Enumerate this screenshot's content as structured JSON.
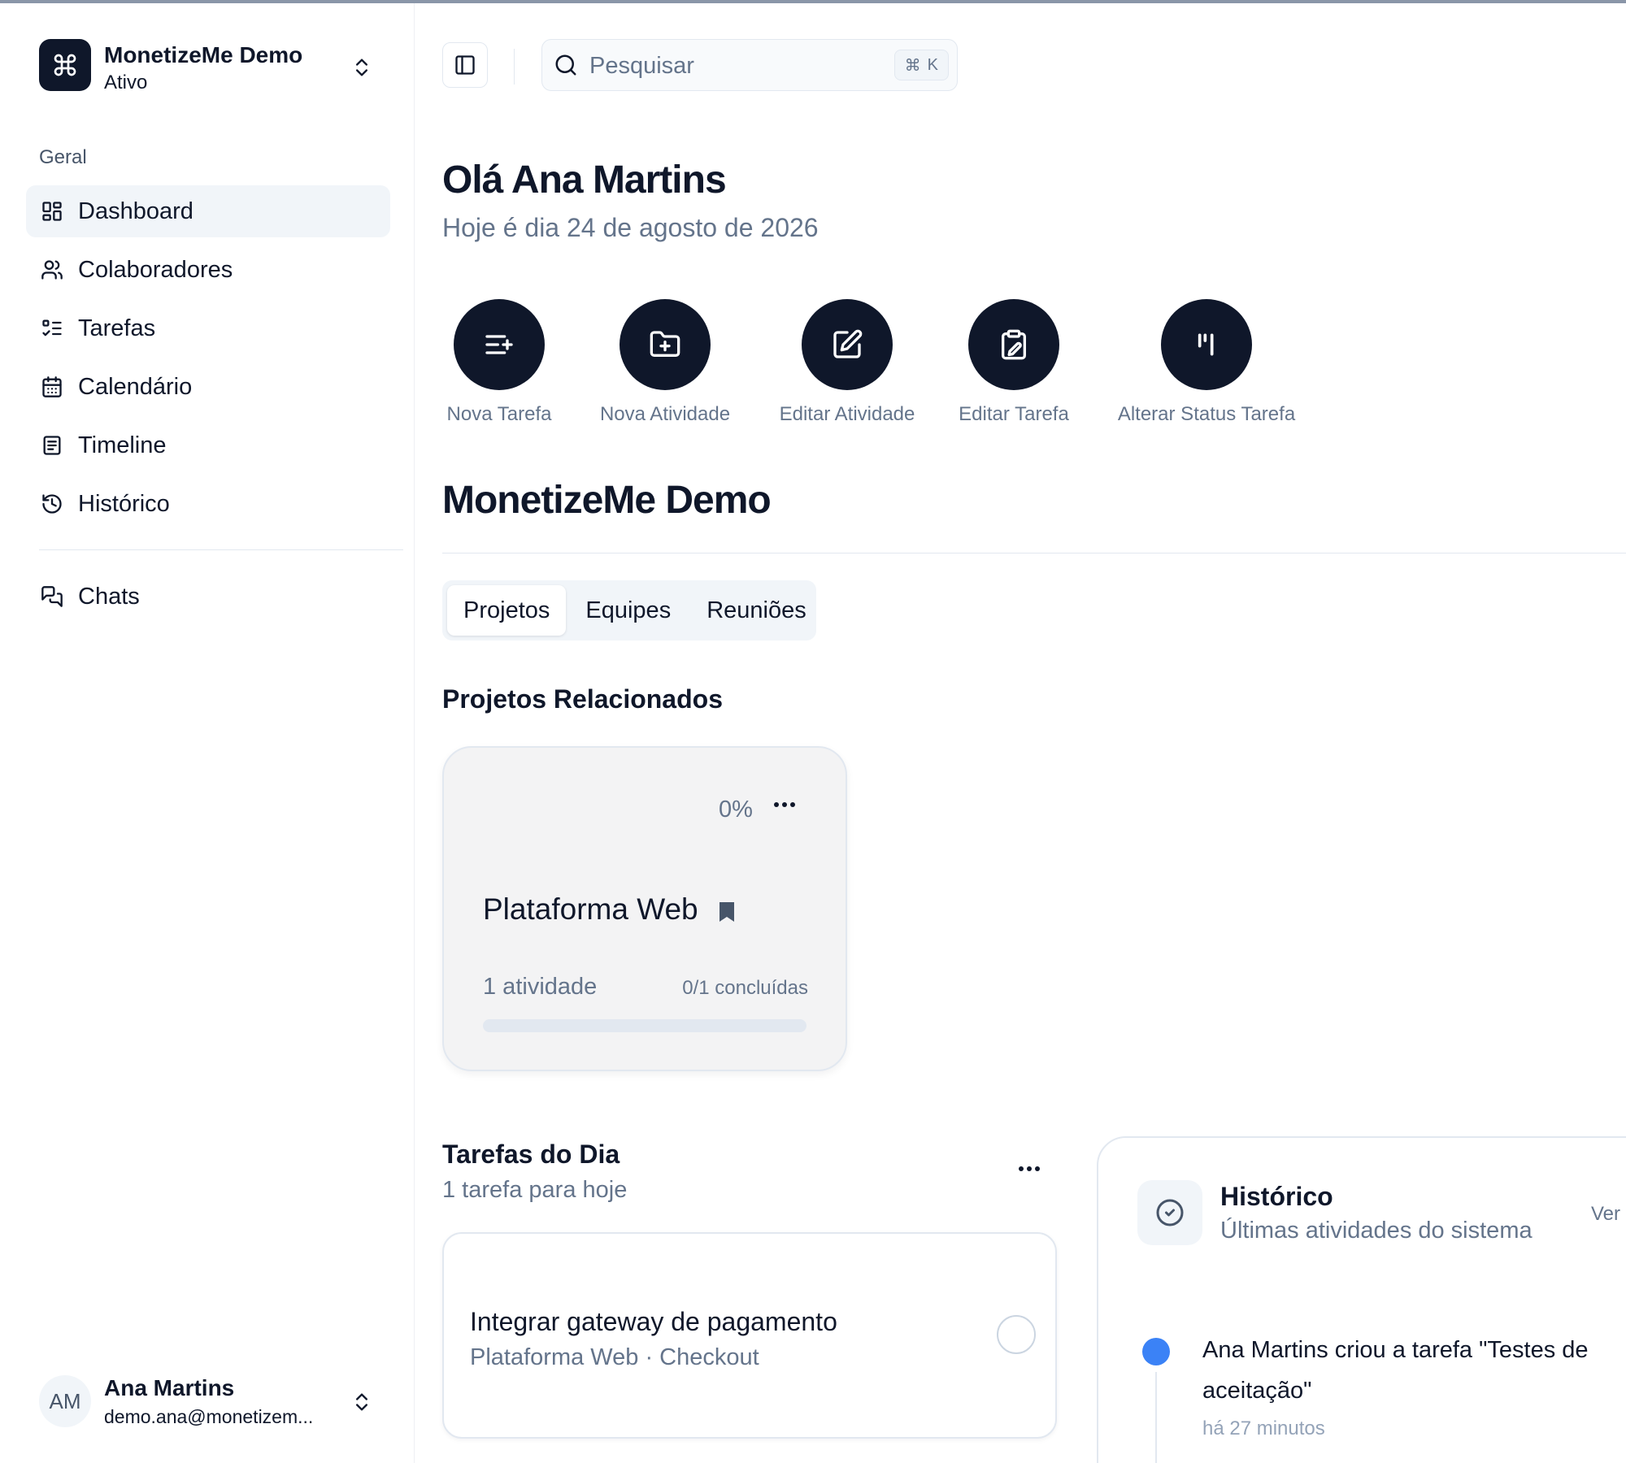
{
  "workspace": {
    "name": "MonetizeMe Demo",
    "status": "Ativo"
  },
  "sidebar": {
    "section_label": "Geral",
    "items": [
      {
        "label": "Dashboard",
        "icon": "layout-dashboard-icon",
        "active": true
      },
      {
        "label": "Colaboradores",
        "icon": "users-icon"
      },
      {
        "label": "Tarefas",
        "icon": "list-checks-icon"
      },
      {
        "label": "Calendário",
        "icon": "calendar-icon"
      },
      {
        "label": "Timeline",
        "icon": "file-text-icon"
      },
      {
        "label": "Histórico",
        "icon": "history-icon"
      }
    ],
    "secondary_items": [
      {
        "label": "Chats",
        "icon": "messages-icon"
      }
    ]
  },
  "user": {
    "initials": "AM",
    "name": "Ana Martins",
    "email": "demo.ana@monetizem..."
  },
  "search": {
    "placeholder": "Pesquisar",
    "shortcut_symbol": "⌘",
    "shortcut_key": "K"
  },
  "header": {
    "greeting": "Olá Ana Martins",
    "date": "Hoje é dia 24 de agosto de 2026"
  },
  "quick_actions": [
    {
      "label": "Nova Tarefa",
      "icon": "list-plus-icon"
    },
    {
      "label": "Nova Atividade",
      "icon": "folder-plus-icon"
    },
    {
      "label": "Editar Atividade",
      "icon": "square-pen-icon"
    },
    {
      "label": "Editar Tarefa",
      "icon": "clipboard-pen-icon"
    },
    {
      "label": "Alterar Status Tarefa",
      "icon": "status-bars-icon"
    }
  ],
  "project_section": {
    "title": "MonetizeMe Demo",
    "tabs": [
      {
        "label": "Projetos",
        "active": true
      },
      {
        "label": "Equipes"
      },
      {
        "label": "Reuniões"
      }
    ],
    "related_title": "Projetos Relacionados"
  },
  "project_card": {
    "percent_label": "0%",
    "progress": 0,
    "name": "Plataforma Web",
    "activities": "1 atividade",
    "completed": "0/1 concluídas"
  },
  "tasks": {
    "title": "Tarefas do Dia",
    "subtitle": "1 tarefa para hoje",
    "items": [
      {
        "name": "Integrar gateway de pagamento",
        "meta": "Plataforma Web · Checkout"
      }
    ]
  },
  "history": {
    "title": "Histórico",
    "subtitle": "Últimas atividades do sistema",
    "view_label": "Ver",
    "entries": [
      {
        "text": "Ana Martins criou a tarefa \"Testes de aceitação\"",
        "time": "há 27 minutos",
        "color": "#3b82f6"
      }
    ]
  },
  "colors": {
    "primary": "#0f172a",
    "muted": "#64748b",
    "accent": "#3b82f6",
    "border": "#e2e8f0"
  }
}
